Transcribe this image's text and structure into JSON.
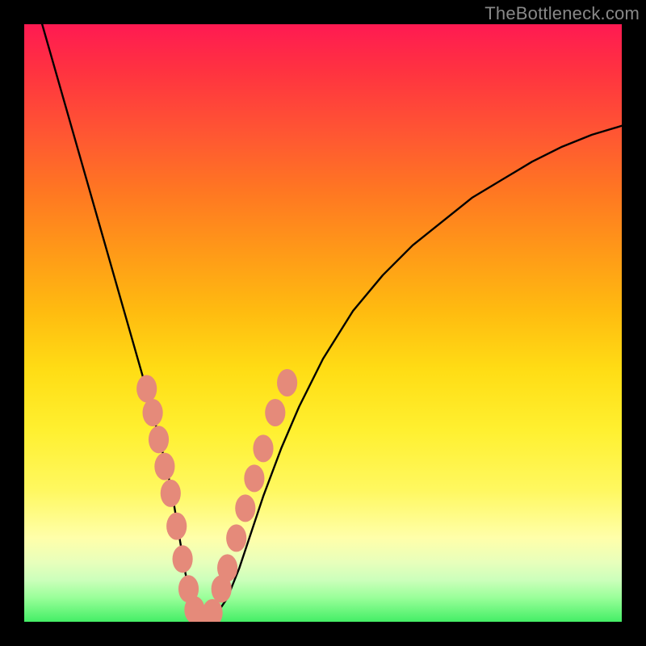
{
  "watermark": "TheBottleneck.com",
  "chart_data": {
    "type": "line",
    "title": "",
    "xlabel": "",
    "ylabel": "",
    "xlim": [
      0,
      100
    ],
    "ylim": [
      0,
      100
    ],
    "grid": false,
    "legend": false,
    "curve": {
      "name": "bottleneck-curve",
      "color": "#000000",
      "x": [
        3,
        5,
        7,
        9,
        11,
        13,
        15,
        17,
        19,
        21,
        22,
        23,
        24,
        25,
        26,
        27,
        28,
        29,
        30,
        31,
        32,
        34,
        36,
        38,
        40,
        43,
        46,
        50,
        55,
        60,
        65,
        70,
        75,
        80,
        85,
        90,
        95,
        100
      ],
      "y": [
        100,
        93,
        86,
        79,
        72,
        65,
        58,
        51,
        44,
        37,
        33,
        29,
        25,
        20,
        14,
        8,
        4,
        1,
        0,
        0,
        1,
        4,
        9,
        15,
        21,
        29,
        36,
        44,
        52,
        58,
        63,
        67,
        71,
        74,
        77,
        79.5,
        81.5,
        83
      ]
    },
    "dots": {
      "name": "sample-points",
      "color": "#e58a7a",
      "radius": 2.0,
      "points": [
        {
          "x": 20.5,
          "y": 39
        },
        {
          "x": 21.5,
          "y": 35
        },
        {
          "x": 22.5,
          "y": 30.5
        },
        {
          "x": 23.5,
          "y": 26
        },
        {
          "x": 24.5,
          "y": 21.5
        },
        {
          "x": 25.5,
          "y": 16
        },
        {
          "x": 26.5,
          "y": 10.5
        },
        {
          "x": 27.5,
          "y": 5.5
        },
        {
          "x": 28.5,
          "y": 2
        },
        {
          "x": 29.2,
          "y": 0.5
        },
        {
          "x": 30.5,
          "y": 0.3
        },
        {
          "x": 31.5,
          "y": 1.5
        },
        {
          "x": 33.0,
          "y": 5.5
        },
        {
          "x": 34.0,
          "y": 9
        },
        {
          "x": 35.5,
          "y": 14
        },
        {
          "x": 37.0,
          "y": 19
        },
        {
          "x": 38.5,
          "y": 24
        },
        {
          "x": 40.0,
          "y": 29
        },
        {
          "x": 42.0,
          "y": 35
        },
        {
          "x": 44.0,
          "y": 40
        }
      ]
    }
  }
}
